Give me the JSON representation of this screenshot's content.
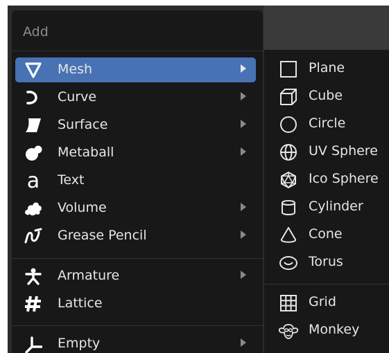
{
  "menu": {
    "title": "Add",
    "items": [
      {
        "label": "Mesh",
        "icon": "mesh-icon",
        "submenu": true,
        "active": true
      },
      {
        "label": "Curve",
        "icon": "curve-icon",
        "submenu": true
      },
      {
        "label": "Surface",
        "icon": "surface-icon",
        "submenu": true
      },
      {
        "label": "Metaball",
        "icon": "metaball-icon",
        "submenu": true
      },
      {
        "label": "Text",
        "icon": "text-icon",
        "submenu": false
      },
      {
        "label": "Volume",
        "icon": "volume-icon",
        "submenu": true
      },
      {
        "label": "Grease Pencil",
        "icon": "grease-pencil-icon",
        "submenu": true
      },
      {
        "label": "Armature",
        "icon": "armature-icon",
        "submenu": true
      },
      {
        "label": "Lattice",
        "icon": "lattice-icon",
        "submenu": false
      },
      {
        "label": "Empty",
        "icon": "empty-icon",
        "submenu": true
      }
    ]
  },
  "submenu": {
    "items": [
      {
        "label": "Plane",
        "icon": "plane-icon"
      },
      {
        "label": "Cube",
        "icon": "cube-icon"
      },
      {
        "label": "Circle",
        "icon": "circle-icon"
      },
      {
        "label": "UV Sphere",
        "icon": "uv-sphere-icon"
      },
      {
        "label": "Ico Sphere",
        "icon": "ico-sphere-icon"
      },
      {
        "label": "Cylinder",
        "icon": "cylinder-icon"
      },
      {
        "label": "Cone",
        "icon": "cone-icon"
      },
      {
        "label": "Torus",
        "icon": "torus-icon"
      },
      {
        "label": "Grid",
        "icon": "grid-icon"
      },
      {
        "label": "Monkey",
        "icon": "monkey-icon"
      }
    ]
  },
  "colors": {
    "highlight": "#4772b3",
    "menu_bg": "#181818",
    "text": "#e6e6e6",
    "title_text": "#8c8c8c"
  }
}
